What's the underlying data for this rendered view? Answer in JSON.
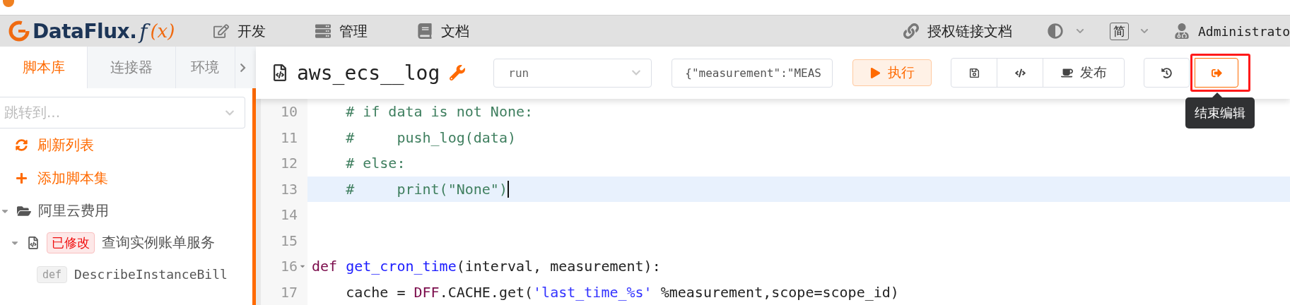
{
  "nav": {
    "logo": {
      "name": "DataFlux.",
      "function": "f",
      "argument": "(x)"
    },
    "menu": [
      {
        "label": "开发"
      },
      {
        "label": "管理"
      },
      {
        "label": "文档"
      }
    ],
    "auth_link": "授权链接文档",
    "language": "简",
    "user": "Administrato"
  },
  "sidebar": {
    "tabs": [
      {
        "label": "脚本库",
        "selected": true
      },
      {
        "label": "连接器",
        "selected": false
      },
      {
        "label": "环境",
        "selected": false
      }
    ],
    "jump": {
      "placeholder": "跳转到..."
    },
    "actions": [
      {
        "label": "刷新列表"
      },
      {
        "label": "添加脚本集"
      }
    ],
    "tree": [
      {
        "label": "阿里云费用",
        "expanded": true,
        "children": [
          {
            "label": "查询实例账单服务",
            "badge": "已修改",
            "expanded": true,
            "children": [
              {
                "tag": "def",
                "label": "DescribeInstanceBill"
              }
            ]
          }
        ]
      }
    ]
  },
  "editor": {
    "title": "aws_ecs__log",
    "function_select": {
      "value": "run"
    },
    "arguments_field": {
      "value": "{\"measurement\":\"MEAS"
    },
    "run_button": "执行",
    "publish_button": "发布",
    "exit_button": {
      "highlighted": true,
      "tooltip": "结束编辑"
    },
    "lines": [
      {
        "number": "10",
        "tokens": [
          {
            "kind": "comment",
            "text": "    # if data is not None:"
          }
        ]
      },
      {
        "number": "11",
        "tokens": [
          {
            "kind": "comment",
            "text": "    #     push_log(data)"
          }
        ]
      },
      {
        "number": "12",
        "tokens": [
          {
            "kind": "comment",
            "text": "    # else:"
          }
        ]
      },
      {
        "number": "13",
        "active": true,
        "cursor": true,
        "tokens": [
          {
            "kind": "comment",
            "text": "    #     print(\"None\")"
          }
        ]
      },
      {
        "number": "14"
      },
      {
        "number": "15"
      },
      {
        "number": "16",
        "foldable": true,
        "tokens": [
          {
            "kind": "keyword",
            "text": "def"
          },
          {
            "kind": "def",
            "text": " get_cron_time"
          },
          {
            "kind": "plain",
            "text": "(interval, measurement):"
          }
        ]
      },
      {
        "number": "17",
        "tokens": [
          {
            "kind": "plain",
            "text": "    cache = "
          },
          {
            "kind": "keyword",
            "text": "DFF"
          },
          {
            "kind": "plain",
            "text": ".CACHE.get("
          },
          {
            "kind": "string",
            "text": "'last_time_%s'"
          },
          {
            "kind": "plain",
            "text": " %measurement,scope=scope_id)"
          }
        ]
      }
    ]
  }
}
